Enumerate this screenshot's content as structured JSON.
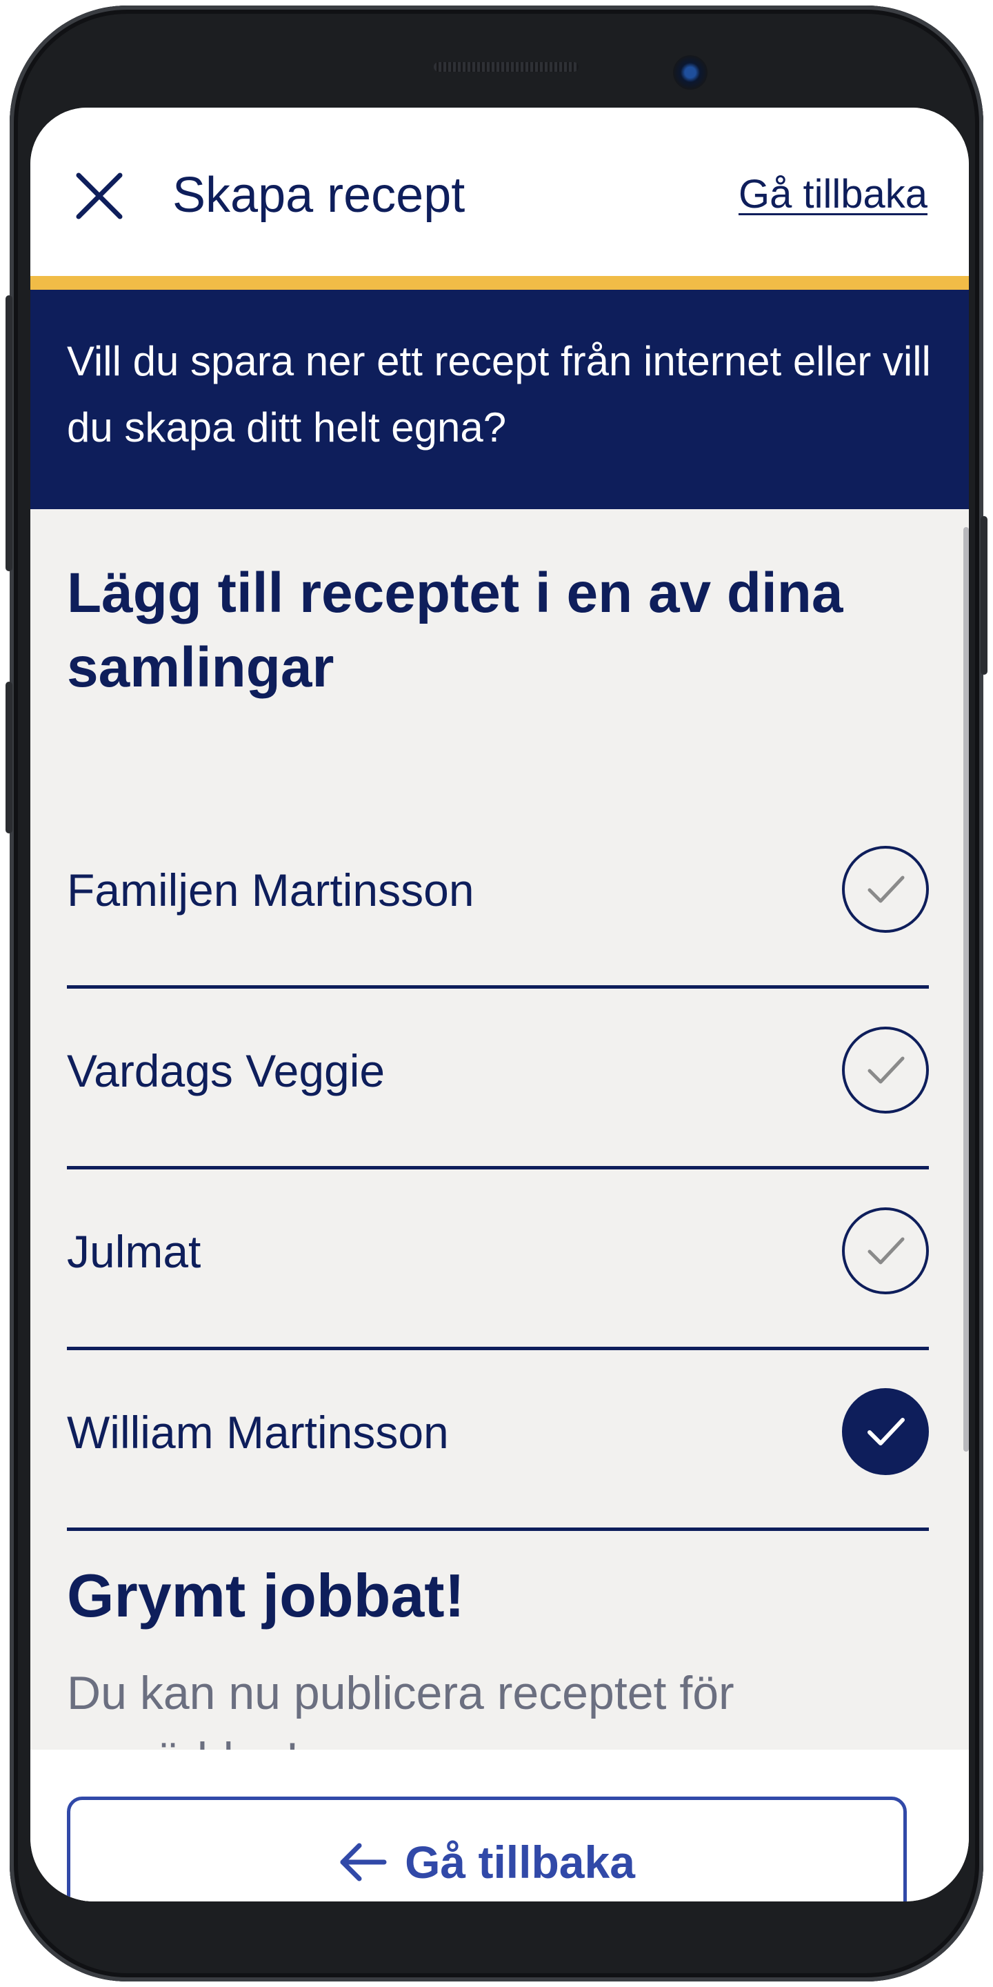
{
  "header": {
    "close_icon": "close-icon",
    "title": "Skapa recept",
    "back_link": "Gå tillbaka"
  },
  "banner": {
    "text": "Vill du spara ner ett recept från internet eller vill du skapa ditt helt egna?"
  },
  "collections": {
    "heading": "Lägg till receptet i en av dina samlingar",
    "items": [
      {
        "name": "Familjen Martinsson",
        "selected": false
      },
      {
        "name": "Vardags Veggie",
        "selected": false
      },
      {
        "name": "Julmat",
        "selected": false
      },
      {
        "name": "William Martinsson",
        "selected": true
      }
    ]
  },
  "completion": {
    "heading": "Grymt jobbat!",
    "text": "Du kan nu publicera receptet för omvärlden!"
  },
  "footer": {
    "button_label": "Gå tillbaka",
    "button_icon": "arrow-left-icon"
  },
  "colors": {
    "navy": "#0e1e5b",
    "accent_yellow": "#f1bc47",
    "button_blue": "#3149a8",
    "background": "#f2f1ef"
  }
}
